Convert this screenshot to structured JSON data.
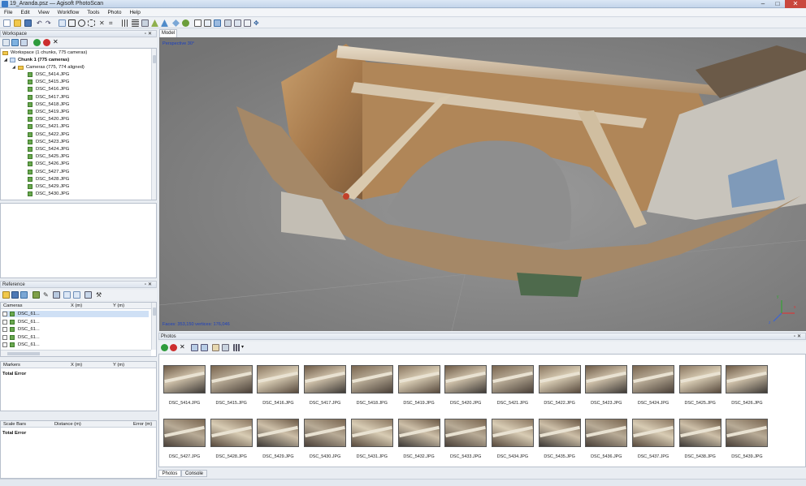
{
  "window": {
    "title": "19_Aranda.psz — Agisoft PhotoScan",
    "minimize": "–",
    "maximize": "□",
    "close": "✕"
  },
  "menu": [
    "File",
    "Edit",
    "View",
    "Workflow",
    "Tools",
    "Photo",
    "Help"
  ],
  "toolbar_icons": [
    "new-icon",
    "open-icon",
    "save-icon",
    "undo-icon",
    "redo-icon",
    "select-icon",
    "rect-select-icon",
    "circle-select-icon",
    "free-select-icon",
    "delete-icon",
    "crop-icon",
    "point-cloud-icon",
    "dense-cloud-icon",
    "shaded-icon",
    "solid-icon",
    "textured-icon",
    "show-cameras-icon",
    "reset-view-icon",
    "zoom-in-icon",
    "zoom-out-icon",
    "navigation-icon"
  ],
  "workspace": {
    "title": "Workspace",
    "root": "Workspace (1 chunks, 775 cameras)",
    "chunk": "Chunk 1 (775 cameras)",
    "cameras_folder": "Cameras (775, 774 aligned)",
    "cameras": [
      "DSC_5414.JPG",
      "DSC_5415.JPG",
      "DSC_5416.JPG",
      "DSC_5417.JPG",
      "DSC_5418.JPG",
      "DSC_5419.JPG",
      "DSC_5420.JPG",
      "DSC_5421.JPG",
      "DSC_5422.JPG",
      "DSC_5423.JPG",
      "DSC_5424.JPG",
      "DSC_5425.JPG",
      "DSC_5426.JPG",
      "DSC_5427.JPG",
      "DSC_5428.JPG",
      "DSC_5429.JPG",
      "DSC_5430.JPG"
    ]
  },
  "reference": {
    "title": "Reference",
    "cameras_table": {
      "headers": [
        "Cameras",
        "X (m)",
        "Y (m)"
      ],
      "rows": [
        "DSC_61...",
        "DSC_61...",
        "DSC_61...",
        "DSC_61...",
        "DSC_61..."
      ]
    },
    "markers_table": {
      "headers": [
        "Markers",
        "X (m)",
        "Y (m)"
      ],
      "total": "Total Error"
    },
    "scalebars_table": {
      "headers": [
        "Scale Bars",
        "Distance (m)",
        "Error (m)"
      ],
      "total": "Total Error"
    }
  },
  "model": {
    "tab": "Model",
    "projection": "Perspective 30°",
    "stats": "Faces: 353,150 vertices: 176,046"
  },
  "photos": {
    "title": "Photos",
    "row1": [
      "DSC_5414.JPG",
      "DSC_5415.JPG",
      "DSC_5416.JPG",
      "DSC_5417.JPG",
      "DSC_5418.JPG",
      "DSC_5419.JPG",
      "DSC_5420.JPG",
      "DSC_5421.JPG",
      "DSC_5422.JPG",
      "DSC_5423.JPG",
      "DSC_5424.JPG",
      "DSC_5425.JPG",
      "DSC_5426.JPG"
    ],
    "row2": [
      "DSC_5427.JPG",
      "DSC_5428.JPG",
      "DSC_5429.JPG",
      "DSC_5430.JPG",
      "DSC_5431.JPG",
      "DSC_5432.JPG",
      "DSC_5433.JPG",
      "DSC_5434.JPG",
      "DSC_5435.JPG",
      "DSC_5436.JPG",
      "DSC_5437.JPG",
      "DSC_5438.JPG",
      "DSC_5439.JPG"
    ],
    "tabs": [
      "Photos",
      "Console"
    ]
  }
}
